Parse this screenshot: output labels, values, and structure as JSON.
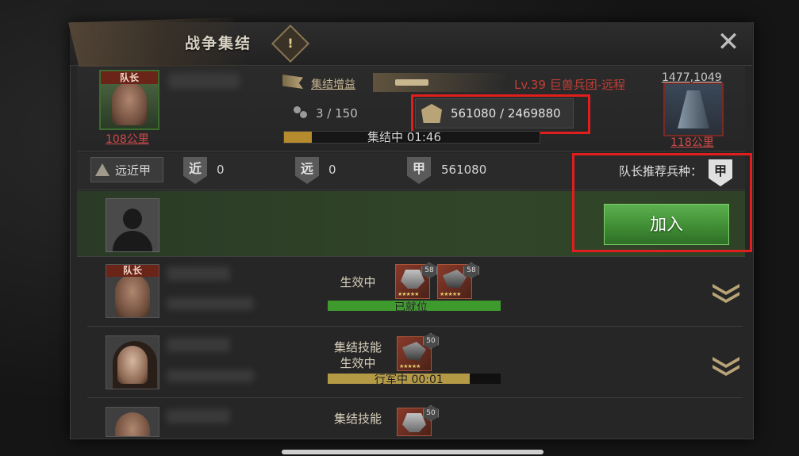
{
  "title": "战争集结",
  "title_icon": "!",
  "header": {
    "leader_tag": "队长",
    "leader_distance": "108公里",
    "bonus_label": "集结增益",
    "target_label": "Lv.39 巨兽兵团-远程",
    "member_count": "3 / 150",
    "power": "561080 / 2469880",
    "progress_text": "集结中 01:46",
    "progress_fraction": 0.11,
    "enemy_coords": "1477,1049",
    "enemy_distance": "118公里"
  },
  "troops": {
    "type_button": "远近甲",
    "melee_icon": "近",
    "melee_value": "0",
    "ranged_icon": "远",
    "ranged_value": "0",
    "armor_icon": "甲",
    "armor_value": "561080",
    "recommend_label": "队长推荐兵种：",
    "recommend_icon": "甲"
  },
  "join_button": "加入",
  "members": [
    {
      "leader_tag": "队长",
      "status": "生效中",
      "units": [
        {
          "level": "58",
          "stars": "★★★★★"
        },
        {
          "level": "58",
          "stars": "★★★★★"
        }
      ],
      "bar_text": "已就位",
      "bar_fraction": 1.0,
      "bar_color": "#3f9a2e"
    },
    {
      "status_line1": "集结技能",
      "status_line2": "生效中",
      "units": [
        {
          "level": "50",
          "stars": "★★★★★"
        }
      ],
      "bar_text": "行军中 00:01",
      "bar_fraction": 0.82,
      "bar_color": "#b59a45"
    },
    {
      "status_line1": "集结技能",
      "units": [
        {
          "level": "50",
          "stars": ""
        }
      ]
    }
  ],
  "colors": {
    "highlight_box": "#e01e1e",
    "accent_gold": "#b8a476",
    "target_red": "#c43d35",
    "join_green": "#4a9c3e"
  }
}
